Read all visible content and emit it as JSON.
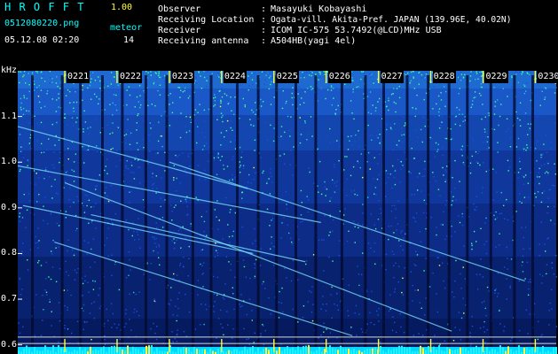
{
  "header": {
    "app_title": "H R O F F T",
    "version": "1.00",
    "filename": "0512080220.png",
    "mode_label": "meteor",
    "datetime": "05.12.08 02:20",
    "count": "14",
    "info_keys": [
      "Observer",
      "Receiving Location",
      "Receiver",
      "Receiving antenna"
    ],
    "info_sep": ":",
    "info_values": [
      "Masayuki Kobayashi",
      "Ogata-vill. Akita-Pref. JAPAN (139.96E, 40.02N)",
      "ICOM IC-575 53.7492(@LCD)MHz USB",
      "A504HB(yagi 4el)"
    ]
  },
  "colors": {
    "background": "#000000",
    "header_text": "#00ffff",
    "info_text": "#ffffff",
    "accent_yellow": "#ffff33",
    "spectrogram_low": "#061a70",
    "spectrogram_mid": "#1850e0",
    "spectrogram_high": "#3cff9a",
    "spectrogram_peak": "#ffff40"
  },
  "chart_data": {
    "type": "heatmap",
    "ylabel": "kHz",
    "ylim": [
      0.58,
      1.2
    ],
    "y_ticks": [
      "1.1",
      "1.0",
      "0.9",
      "0.8",
      "0.7",
      "0.6"
    ],
    "y_tick_values": [
      1.1,
      1.0,
      0.9,
      0.8,
      0.7,
      0.6
    ],
    "time_labels": [
      "0221",
      "0222",
      "0223",
      "0224",
      "0225",
      "0226",
      "0227",
      "0228",
      "0229",
      "0230"
    ],
    "time_minutes": [
      21,
      22,
      23,
      24,
      25,
      26,
      27,
      28,
      29,
      30
    ],
    "xlim_minutes": [
      20.1,
      30.4
    ],
    "reference_lines_khz": [
      0.617,
      0.603
    ],
    "meteor_count": 14,
    "dropouts_minutes": [
      20.38,
      20.95,
      21.3,
      21.72,
      22.1,
      22.55,
      22.95,
      23.45,
      23.8,
      24.3,
      24.7,
      25.05,
      25.42,
      25.8,
      26.3,
      26.75,
      27.1,
      27.55,
      27.95,
      28.35,
      28.7,
      29.15,
      29.6,
      29.95
    ],
    "carrier_traces": [
      {
        "start_min": 20.1,
        "end_min": 24.5,
        "start_khz": 1.078,
        "end_khz": 0.942
      },
      {
        "start_min": 20.1,
        "end_min": 25.9,
        "start_khz": 0.992,
        "end_khz": 0.868
      },
      {
        "start_min": 21.0,
        "end_min": 28.4,
        "start_khz": 0.955,
        "end_khz": 0.63
      },
      {
        "start_min": 20.2,
        "end_min": 24.6,
        "start_khz": 0.905,
        "end_khz": 0.8
      },
      {
        "start_min": 21.5,
        "end_min": 25.6,
        "start_khz": 0.885,
        "end_khz": 0.782
      },
      {
        "start_min": 20.8,
        "end_min": 26.5,
        "start_khz": 0.825,
        "end_khz": 0.62
      },
      {
        "start_min": 23.0,
        "end_min": 29.8,
        "start_khz": 1.0,
        "end_khz": 0.74
      }
    ]
  }
}
